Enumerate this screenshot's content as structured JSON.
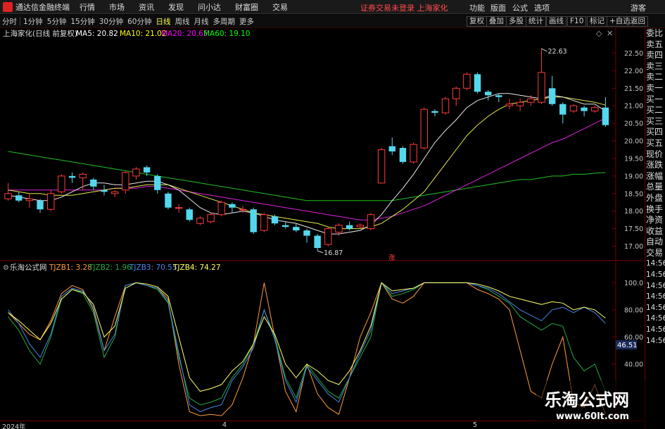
{
  "menubar": {
    "app_title": "通达信金融终端",
    "items": [
      "行情",
      "市场",
      "资讯",
      "发现",
      "问小达",
      "财富圈",
      "交易"
    ],
    "notice": "证券交易未登录  上海家化",
    "right_items": [
      "功能",
      "版面",
      "公式",
      "选项"
    ],
    "user": "游客"
  },
  "toolbar": {
    "periods": [
      "分时",
      "1分钟",
      "5分钟",
      "15分钟",
      "30分钟",
      "60分钟",
      "日线",
      "周线",
      "月线",
      "多周期",
      "更多"
    ],
    "active_period": "日线",
    "right_buttons": [
      "复权",
      "叠加",
      "多股",
      "统计",
      "画线",
      "F10",
      "标记",
      "+自选",
      "返回"
    ]
  },
  "main_chart": {
    "stock_label": "上海家化(日线 前复权)",
    "ma_labels": [
      {
        "text": "MA5: 20.82",
        "color": "#ffffff"
      },
      {
        "text": "MA10: 21.02",
        "color": "#ffff00"
      },
      {
        "text": "MA20: 20.65",
        "color": "#ff00ff"
      },
      {
        "text": "MA60: 19.10",
        "color": "#00ff00"
      }
    ],
    "high_label": "22.63",
    "low_label": "16.87",
    "rise_marker": "涨",
    "price_axis": [
      "22.50",
      "22.00",
      "21.50",
      "21.00",
      "20.50",
      "20.00",
      "19.50",
      "19.00",
      "18.50",
      "18.00",
      "17.50",
      "17.00"
    ]
  },
  "indicator": {
    "name": "乐淘公式网",
    "lines": [
      {
        "text": "TJZB1: 3.28",
        "color": "#ff9a3c"
      },
      {
        "text": "TJZB2: 1.96",
        "color": "#22aa44"
      },
      {
        "text": "TJZB3: 70.55",
        "color": "#4a86e8"
      },
      {
        "text": "TJZB4: 74.27",
        "color": "#ffff66"
      }
    ],
    "axis": [
      "100.0",
      "80.00",
      "60.00",
      "40.00"
    ],
    "current_value": "46.51"
  },
  "right_panel": {
    "items": [
      "委比",
      "卖五",
      "卖四",
      "卖三",
      "卖二",
      "卖一",
      "买一",
      "买二",
      "买三",
      "买四",
      "买五",
      "现价",
      "涨跌",
      "涨幅",
      "总量",
      "外盘",
      "换手",
      "净资",
      "收益",
      "自动",
      "交易"
    ],
    "times": [
      "14:56",
      "14:56",
      "14:56",
      "14:56",
      "14:56",
      "14:56",
      "14:56",
      "14:56"
    ]
  },
  "time_axis": [
    "2024年",
    "4",
    "5"
  ],
  "watermark": {
    "title": "乐淘公式网",
    "url": "www.60lt.com"
  },
  "chart_data": {
    "type": "candlestick",
    "price_range": [
      16.75,
      22.85
    ],
    "candles": [
      {
        "o": 18.35,
        "c": 18.5,
        "h": 18.8,
        "l": 18.3
      },
      {
        "o": 18.45,
        "c": 18.3,
        "h": 18.55,
        "l": 18.25
      },
      {
        "o": 18.3,
        "c": 18.35,
        "h": 18.5,
        "l": 18.1
      },
      {
        "o": 18.3,
        "c": 18.05,
        "h": 18.35,
        "l": 17.95
      },
      {
        "o": 18.05,
        "c": 18.5,
        "h": 18.6,
        "l": 18.0
      },
      {
        "o": 18.55,
        "c": 19.0,
        "h": 19.05,
        "l": 18.5
      },
      {
        "o": 19.0,
        "c": 18.95,
        "h": 19.1,
        "l": 18.8
      },
      {
        "o": 18.95,
        "c": 19.05,
        "h": 19.1,
        "l": 18.6
      },
      {
        "o": 18.9,
        "c": 18.7,
        "h": 18.95,
        "l": 18.6
      },
      {
        "o": 18.6,
        "c": 18.55,
        "h": 18.75,
        "l": 18.45
      },
      {
        "o": 18.5,
        "c": 18.55,
        "h": 18.6,
        "l": 18.4
      },
      {
        "o": 18.6,
        "c": 19.1,
        "h": 19.15,
        "l": 18.5
      },
      {
        "o": 19.0,
        "c": 19.2,
        "h": 19.25,
        "l": 18.9
      },
      {
        "o": 19.25,
        "c": 19.1,
        "h": 19.3,
        "l": 19.0
      },
      {
        "o": 19.0,
        "c": 18.6,
        "h": 19.05,
        "l": 18.5
      },
      {
        "o": 18.5,
        "c": 18.1,
        "h": 18.55,
        "l": 18.05
      },
      {
        "o": 18.1,
        "c": 18.1,
        "h": 18.2,
        "l": 17.95
      },
      {
        "o": 18.05,
        "c": 17.75,
        "h": 18.1,
        "l": 17.7
      },
      {
        "o": 17.65,
        "c": 17.8,
        "h": 17.85,
        "l": 17.6
      },
      {
        "o": 17.7,
        "c": 17.9,
        "h": 17.95,
        "l": 17.65
      },
      {
        "o": 17.9,
        "c": 18.25,
        "h": 18.3,
        "l": 17.85
      },
      {
        "o": 18.2,
        "c": 18.1,
        "h": 18.25,
        "l": 17.95
      },
      {
        "o": 18.05,
        "c": 18.05,
        "h": 18.15,
        "l": 17.95
      },
      {
        "o": 18.05,
        "c": 17.4,
        "h": 18.1,
        "l": 17.35
      },
      {
        "o": 17.45,
        "c": 17.9,
        "h": 17.95,
        "l": 17.4
      },
      {
        "o": 17.85,
        "c": 17.65,
        "h": 17.9,
        "l": 17.6
      },
      {
        "o": 17.6,
        "c": 17.55,
        "h": 17.7,
        "l": 17.5
      },
      {
        "o": 17.55,
        "c": 17.45,
        "h": 17.65,
        "l": 17.4
      },
      {
        "o": 17.45,
        "c": 17.3,
        "h": 17.5,
        "l": 17.1
      },
      {
        "o": 17.3,
        "c": 16.95,
        "h": 17.35,
        "l": 16.87
      },
      {
        "o": 17.05,
        "c": 17.5,
        "h": 17.55,
        "l": 17.0
      },
      {
        "o": 17.4,
        "c": 17.6,
        "h": 17.65,
        "l": 17.3
      },
      {
        "o": 17.6,
        "c": 17.5,
        "h": 17.7,
        "l": 17.45
      },
      {
        "o": 17.55,
        "c": 17.6,
        "h": 17.65,
        "l": 17.5
      },
      {
        "o": 17.5,
        "c": 17.9,
        "h": 17.95,
        "l": 17.45
      },
      {
        "o": 18.8,
        "c": 19.75,
        "h": 19.8,
        "l": 18.8
      },
      {
        "o": 19.85,
        "c": 19.7,
        "h": 20.1,
        "l": 19.6
      },
      {
        "o": 19.8,
        "c": 19.4,
        "h": 19.85,
        "l": 19.35
      },
      {
        "o": 19.4,
        "c": 19.9,
        "h": 19.95,
        "l": 19.35
      },
      {
        "o": 19.8,
        "c": 20.9,
        "h": 20.95,
        "l": 19.75
      },
      {
        "o": 20.85,
        "c": 20.8,
        "h": 20.9,
        "l": 20.7
      },
      {
        "o": 20.8,
        "c": 21.2,
        "h": 21.25,
        "l": 20.75
      },
      {
        "o": 21.2,
        "c": 21.5,
        "h": 21.55,
        "l": 21.0
      },
      {
        "o": 21.5,
        "c": 21.9,
        "h": 21.95,
        "l": 21.45
      },
      {
        "o": 21.9,
        "c": 21.4,
        "h": 21.95,
        "l": 21.35
      },
      {
        "o": 21.4,
        "c": 21.3,
        "h": 21.45,
        "l": 21.15
      },
      {
        "o": 21.3,
        "c": 21.25,
        "h": 21.35,
        "l": 21.1
      },
      {
        "o": 21.0,
        "c": 21.05,
        "h": 21.2,
        "l": 20.9
      },
      {
        "o": 21.0,
        "c": 21.1,
        "h": 21.2,
        "l": 20.85
      },
      {
        "o": 21.1,
        "c": 21.2,
        "h": 21.3,
        "l": 21.0
      },
      {
        "o": 21.1,
        "c": 21.95,
        "h": 22.63,
        "l": 21.05
      },
      {
        "o": 21.5,
        "c": 21.05,
        "h": 21.85,
        "l": 21.0
      },
      {
        "o": 21.05,
        "c": 20.75,
        "h": 21.1,
        "l": 20.5
      },
      {
        "o": 20.85,
        "c": 21.0,
        "h": 21.05,
        "l": 20.8
      },
      {
        "o": 20.95,
        "c": 20.85,
        "h": 21.0,
        "l": 20.7
      },
      {
        "o": 20.85,
        "c": 20.95,
        "h": 21.0,
        "l": 20.8
      },
      {
        "o": 20.95,
        "c": 20.45,
        "h": 21.25,
        "l": 20.4
      }
    ],
    "ma5": [
      18.45,
      18.4,
      18.35,
      18.3,
      18.3,
      18.4,
      18.55,
      18.7,
      18.8,
      18.8,
      18.75,
      18.75,
      18.8,
      18.85,
      18.85,
      18.75,
      18.6,
      18.35,
      18.1,
      17.95,
      17.9,
      17.95,
      18.0,
      17.95,
      17.85,
      17.75,
      17.7,
      17.65,
      17.55,
      17.45,
      17.35,
      17.35,
      17.4,
      17.45,
      17.6,
      17.9,
      18.3,
      18.65,
      19.05,
      19.5,
      19.95,
      20.3,
      20.6,
      20.95,
      21.15,
      21.25,
      21.35,
      21.35,
      21.3,
      21.25,
      21.2,
      21.3,
      21.25,
      21.15,
      21.05,
      21.05,
      20.85
    ],
    "ma10": [
      18.6,
      18.55,
      18.5,
      18.5,
      18.45,
      18.45,
      18.45,
      18.5,
      18.55,
      18.6,
      18.65,
      18.65,
      18.7,
      18.75,
      18.75,
      18.75,
      18.65,
      18.55,
      18.45,
      18.35,
      18.25,
      18.15,
      18.05,
      17.95,
      17.9,
      17.85,
      17.8,
      17.75,
      17.7,
      17.65,
      17.55,
      17.5,
      17.5,
      17.5,
      17.55,
      17.65,
      17.85,
      18.05,
      18.3,
      18.55,
      18.95,
      19.35,
      19.75,
      20.15,
      20.45,
      20.7,
      20.9,
      21.05,
      21.1,
      21.15,
      21.2,
      21.25,
      21.25,
      21.2,
      21.15,
      21.1,
      21.02
    ],
    "ma20": [
      18.6,
      18.6,
      18.6,
      18.6,
      18.6,
      18.6,
      18.6,
      18.6,
      18.6,
      18.6,
      18.65,
      18.65,
      18.65,
      18.7,
      18.7,
      18.65,
      18.6,
      18.55,
      18.5,
      18.45,
      18.4,
      18.35,
      18.3,
      18.25,
      18.2,
      18.15,
      18.1,
      18.05,
      18.0,
      17.95,
      17.9,
      17.85,
      17.8,
      17.75,
      17.75,
      17.8,
      17.85,
      17.95,
      18.05,
      18.15,
      18.3,
      18.45,
      18.6,
      18.75,
      18.9,
      19.05,
      19.2,
      19.35,
      19.5,
      19.65,
      19.8,
      19.95,
      20.05,
      20.2,
      20.35,
      20.5,
      20.65
    ],
    "ma60": [
      19.7,
      19.65,
      19.6,
      19.55,
      19.5,
      19.45,
      19.4,
      19.35,
      19.3,
      19.25,
      19.2,
      19.15,
      19.1,
      19.05,
      19.0,
      18.95,
      18.9,
      18.85,
      18.8,
      18.75,
      18.7,
      18.65,
      18.6,
      18.55,
      18.5,
      18.45,
      18.4,
      18.35,
      18.3,
      18.3,
      18.3,
      18.3,
      18.3,
      18.3,
      18.3,
      18.3,
      18.3,
      18.35,
      18.4,
      18.45,
      18.5,
      18.55,
      18.6,
      18.65,
      18.7,
      18.75,
      18.8,
      18.85,
      18.9,
      18.9,
      18.95,
      19.0,
      19.0,
      19.05,
      19.05,
      19.08,
      19.1
    ],
    "indicator_series": [
      {
        "name": "TJZB1",
        "values": [
          78,
          70,
          62,
          58,
          72,
          92,
          98,
          95,
          80,
          50,
          75,
          98,
          100,
          98,
          96,
          88,
          40,
          5,
          2,
          3,
          2,
          10,
          30,
          55,
          100,
          60,
          20,
          5,
          40,
          18,
          8,
          3,
          30,
          60,
          78,
          100,
          88,
          85,
          90,
          100,
          100,
          100,
          100,
          100,
          95,
          92,
          88,
          80,
          50,
          20,
          15,
          40,
          60,
          12,
          8,
          25,
          3
        ]
      },
      {
        "name": "TJZB2",
        "values": [
          75,
          65,
          50,
          40,
          60,
          88,
          95,
          92,
          78,
          45,
          60,
          98,
          100,
          98,
          95,
          85,
          45,
          15,
          10,
          12,
          15,
          30,
          40,
          55,
          80,
          60,
          30,
          15,
          40,
          30,
          20,
          15,
          30,
          45,
          60,
          100,
          90,
          92,
          95,
          100,
          100,
          100,
          100,
          100,
          98,
          95,
          90,
          85,
          75,
          70,
          65,
          70,
          68,
          45,
          35,
          40,
          20
        ]
      },
      {
        "name": "TJZB3",
        "values": [
          80,
          70,
          55,
          45,
          62,
          90,
          96,
          94,
          82,
          50,
          62,
          98,
          100,
          98,
          96,
          86,
          48,
          10,
          5,
          8,
          10,
          28,
          38,
          52,
          80,
          58,
          28,
          12,
          38,
          28,
          18,
          12,
          30,
          48,
          65,
          100,
          92,
          94,
          96,
          100,
          100,
          100,
          100,
          100,
          98,
          96,
          92,
          86,
          80,
          76,
          72,
          80,
          82,
          78,
          82,
          78,
          70
        ]
      },
      {
        "name": "TJZB4",
        "values": [
          78,
          72,
          65,
          58,
          70,
          88,
          95,
          93,
          84,
          60,
          68,
          96,
          100,
          99,
          97,
          90,
          60,
          30,
          20,
          22,
          25,
          35,
          42,
          55,
          75,
          62,
          40,
          30,
          40,
          35,
          28,
          25,
          35,
          50,
          68,
          100,
          94,
          95,
          96,
          100,
          100,
          100,
          100,
          100,
          99,
          97,
          94,
          90,
          88,
          86,
          84,
          86,
          85,
          80,
          82,
          80,
          74
        ]
      }
    ],
    "indicator_range": [
      0,
      108
    ]
  }
}
